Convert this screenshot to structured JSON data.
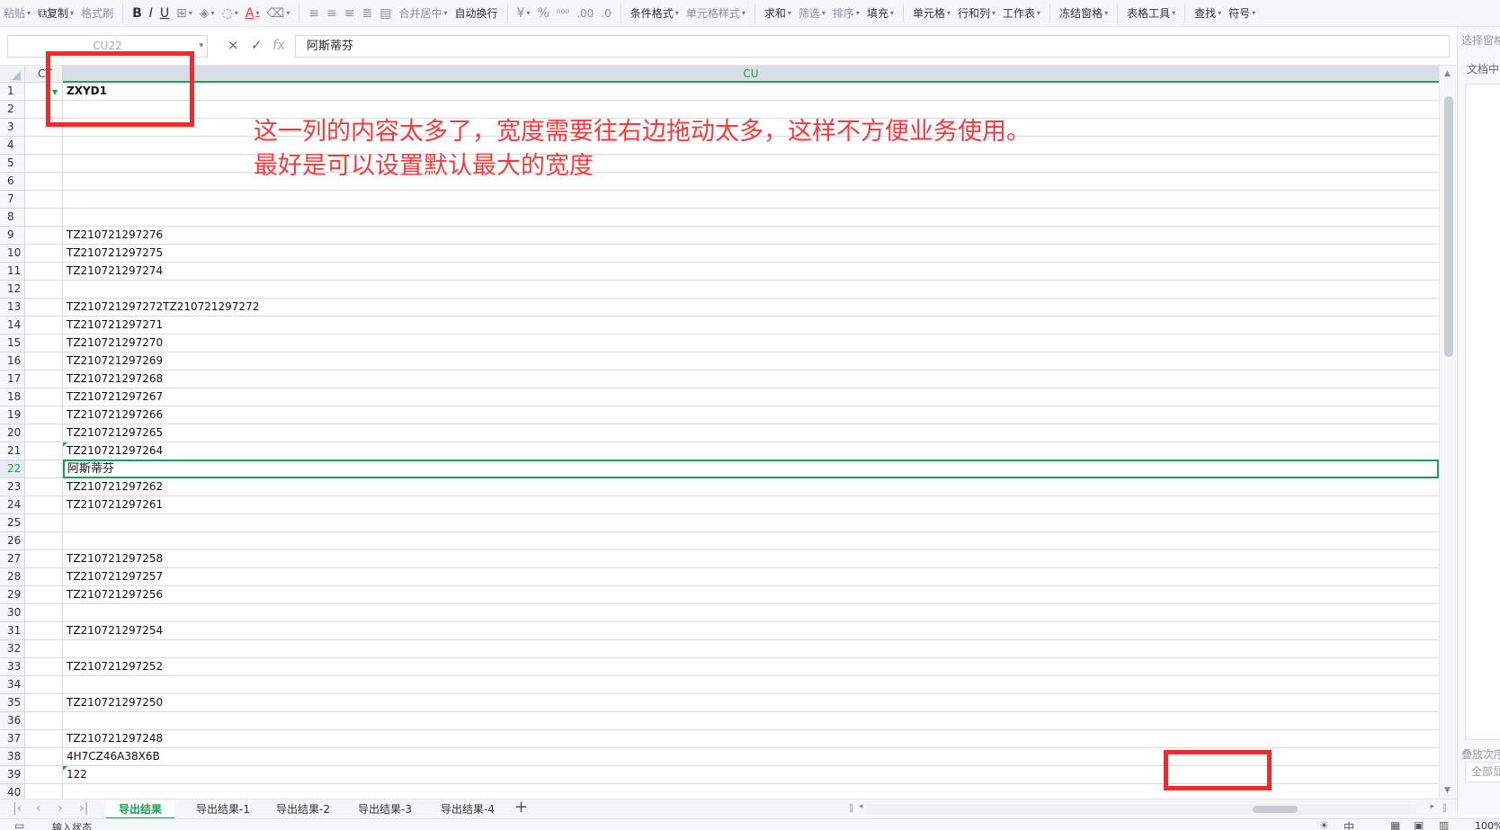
{
  "toolbar": {
    "paste": "粘贴",
    "copy": "复制",
    "format_painter": "格式刷",
    "bold": "B",
    "italic": "I",
    "underline": "U",
    "font_color": "A",
    "merge_center": "合并居中",
    "wrap_text": "自动换行",
    "currency": "¥",
    "percent": "%",
    "conditional_format": "条件格式",
    "cell_style": "单元格样式",
    "sum": "求和",
    "filter": "筛选",
    "sort": "排序",
    "fill": "填充",
    "cell": "单元格",
    "row_col": "行和列",
    "worksheet": "工作表",
    "freeze": "冻结窗格",
    "table_tools": "表格工具",
    "find": "查找",
    "symbol": "符号"
  },
  "formula_bar": {
    "name_box": "CU22",
    "cancel": "×",
    "confirm": "✓",
    "fx": "fx",
    "value": "阿斯蒂芬"
  },
  "right_pane": {
    "title": "选择窗格",
    "doc_label": "文档中",
    "stack_label": "叠放次序",
    "show_all": "全部显示"
  },
  "grid": {
    "columns": [
      "CT",
      "CU"
    ],
    "rows": [
      {
        "n": "1",
        "v": "ZXYD1"
      },
      {
        "n": "2",
        "v": ""
      },
      {
        "n": "3",
        "v": ""
      },
      {
        "n": "4",
        "v": ""
      },
      {
        "n": "5",
        "v": ""
      },
      {
        "n": "6",
        "v": ""
      },
      {
        "n": "7",
        "v": ""
      },
      {
        "n": "8",
        "v": ""
      },
      {
        "n": "9",
        "v": "TZ210721297276"
      },
      {
        "n": "10",
        "v": "TZ210721297275"
      },
      {
        "n": "11",
        "v": "TZ210721297274"
      },
      {
        "n": "12",
        "v": ""
      },
      {
        "n": "13",
        "v": "TZ210721297272TZ210721297272"
      },
      {
        "n": "14",
        "v": "TZ210721297271"
      },
      {
        "n": "15",
        "v": "TZ210721297270"
      },
      {
        "n": "16",
        "v": "TZ210721297269"
      },
      {
        "n": "17",
        "v": "TZ210721297268"
      },
      {
        "n": "18",
        "v": "TZ210721297267"
      },
      {
        "n": "19",
        "v": "TZ210721297266"
      },
      {
        "n": "20",
        "v": "TZ210721297265"
      },
      {
        "n": "21",
        "v": "TZ210721297264"
      },
      {
        "n": "22",
        "v": "阿斯蒂芬"
      },
      {
        "n": "23",
        "v": "TZ210721297262"
      },
      {
        "n": "24",
        "v": "TZ210721297261"
      },
      {
        "n": "25",
        "v": ""
      },
      {
        "n": "26",
        "v": ""
      },
      {
        "n": "27",
        "v": "TZ210721297258"
      },
      {
        "n": "28",
        "v": "TZ210721297257"
      },
      {
        "n": "29",
        "v": "TZ210721297256"
      },
      {
        "n": "30",
        "v": ""
      },
      {
        "n": "31",
        "v": "TZ210721297254"
      },
      {
        "n": "32",
        "v": ""
      },
      {
        "n": "33",
        "v": "TZ210721297252"
      },
      {
        "n": "34",
        "v": ""
      },
      {
        "n": "35",
        "v": "TZ210721297250"
      },
      {
        "n": "36",
        "v": ""
      },
      {
        "n": "37",
        "v": "TZ210721297248"
      },
      {
        "n": "38",
        "v": "4H7CZ46A38X6B"
      },
      {
        "n": "39",
        "v": "122"
      },
      {
        "n": "40",
        "v": ""
      }
    ],
    "active_row": "22",
    "bold_row": "1"
  },
  "annotation": {
    "line1": "这一列的内容太多了，宽度需要往右边拖动太多，这样不方便业务使用。",
    "line2": "最好是可以设置默认最大的宽度",
    "color": "#ef2a2a"
  },
  "sheets": {
    "tabs": [
      "导出结果",
      "导出结果-1",
      "导出结果-2",
      "导出结果-3",
      "导出结果-4"
    ],
    "active": "导出结果",
    "add": "+"
  },
  "status_bar": {
    "status": "输入状态",
    "zoom": "100%"
  },
  "colors": {
    "accent_green": "#1e9e57",
    "annotation_red": "#ef2a2a"
  }
}
